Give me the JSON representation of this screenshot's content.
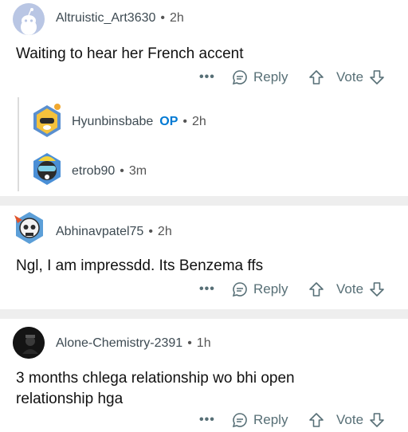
{
  "comments": [
    {
      "user": "Altruistic_Art3630",
      "time": "2h",
      "text": "Waiting to hear her French accent",
      "reply_label": "Reply",
      "vote_label": "Vote"
    },
    {
      "user": "Abhinavpatel75",
      "time": "2h",
      "text": "Ngl, I am impressdd. Its Benzema ffs",
      "reply_label": "Reply",
      "vote_label": "Vote"
    },
    {
      "user": "Alone-Chemistry-2391",
      "time": "1h",
      "text": "3 months chlega relationship wo bhi open relationship hga",
      "reply_label": "Reply",
      "vote_label": "Vote"
    }
  ],
  "replies": [
    {
      "user": "Hyunbinsbabe",
      "op_badge": "OP",
      "time": "2h"
    },
    {
      "user": "etrob90",
      "time": "3m"
    }
  ],
  "more_label": "•••",
  "separator": "•",
  "colors": {
    "op": "#0079d3",
    "meta": "#576f76",
    "divider": "#eeeeee"
  },
  "icons": [
    "reddit-default-avatar-icon",
    "comment-bubble-icon",
    "upvote-arrow-icon",
    "downvote-arrow-icon",
    "more-dots-icon"
  ]
}
